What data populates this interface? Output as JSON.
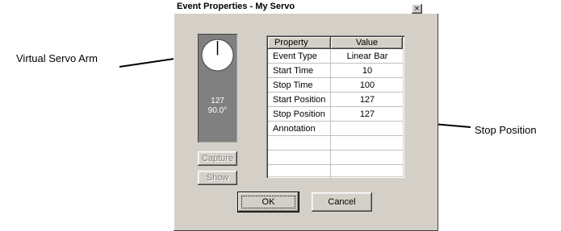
{
  "annotations": {
    "servo_arm": "Virtual Servo Arm",
    "stop_position": "Stop Position"
  },
  "dialog": {
    "title": "Event Properties - My Servo",
    "close_glyph": "×"
  },
  "servo": {
    "value": "127",
    "angle": "90.0°"
  },
  "buttons": {
    "capture": "Capture",
    "show": "Show",
    "ok": "OK",
    "cancel": "Cancel"
  },
  "table": {
    "headers": {
      "property": "Property",
      "value": "Value"
    },
    "rows": [
      {
        "property": "Event Type",
        "value": "Linear Bar"
      },
      {
        "property": "Start Time",
        "value": "10"
      },
      {
        "property": "Stop Time",
        "value": "100"
      },
      {
        "property": "Start Position",
        "value": "127"
      },
      {
        "property": "Stop Position",
        "value": "127"
      },
      {
        "property": "Annotation",
        "value": ""
      },
      {
        "property": "",
        "value": ""
      },
      {
        "property": "",
        "value": ""
      },
      {
        "property": "",
        "value": ""
      }
    ]
  }
}
